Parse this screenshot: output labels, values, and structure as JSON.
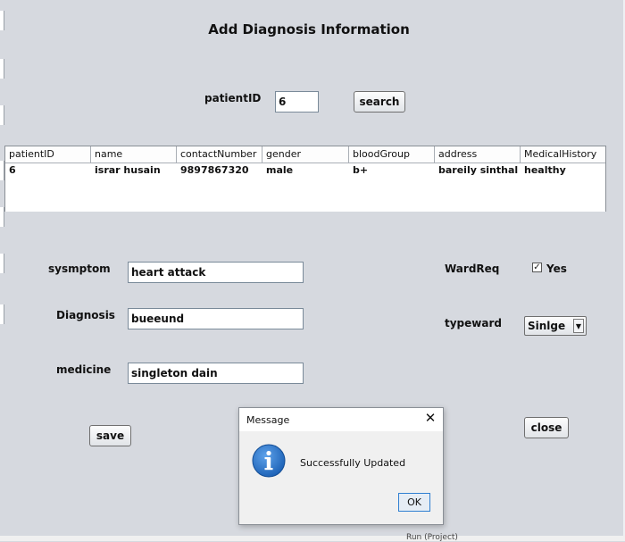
{
  "form": {
    "title": "Add Diagnosis Information",
    "patient_id_label": "patientID",
    "patient_id_value": "6",
    "search_button": "search",
    "symptom_label": "sysmptom",
    "symptom_value": "heart attack",
    "diagnosis_label": "Diagnosis",
    "diagnosis_value": "bueeund",
    "medicine_label": "medicine",
    "medicine_value": "singleton dain",
    "ward_req_label": "WardReq",
    "ward_req_checkbox": "Yes",
    "ward_req_checked": true,
    "type_ward_label": "typeward",
    "type_ward_value": "Sinlge",
    "save_button": "save",
    "close_button": "close"
  },
  "table": {
    "columns": [
      "patientID",
      "name",
      "contactNumber",
      "gender",
      "bloodGroup",
      "address",
      "MedicalHistory"
    ],
    "rows": [
      [
        "6",
        "israr husain",
        "9897867320",
        "male",
        "b+",
        "bareily sinthal",
        "healthy"
      ]
    ]
  },
  "dialog": {
    "title": "Message",
    "message": "Successfully Updated",
    "ok_button": "OK"
  },
  "background": {
    "bottom_text": "Run (Project)"
  }
}
